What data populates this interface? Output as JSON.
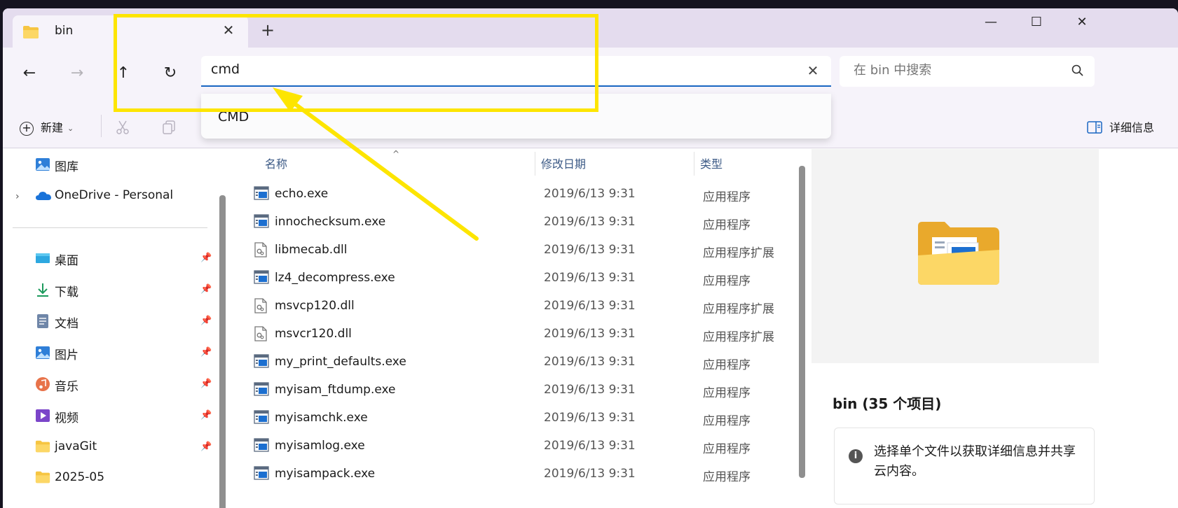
{
  "tab": {
    "title": "bin",
    "close": "✕"
  },
  "new_tab": "+",
  "window_controls": {
    "minimize": "—",
    "maximize": "☐",
    "close": "✕"
  },
  "nav": {
    "back": "←",
    "forward": "→",
    "up": "↑",
    "refresh": "↻"
  },
  "address": {
    "value": "cmd",
    "clear": "✕"
  },
  "suggestion": {
    "label": "CMD"
  },
  "search": {
    "placeholder": "在 bin 中搜索"
  },
  "toolbar": {
    "new_label": "新建",
    "details_label": "详细信息"
  },
  "sidebar": {
    "items": [
      {
        "label": "图库",
        "icon": "gallery-icon",
        "pinned": false
      },
      {
        "label": "OneDrive - Personal",
        "icon": "onedrive-icon",
        "pinned": false
      },
      {
        "label": "桌面",
        "icon": "desktop-icon",
        "pinned": true
      },
      {
        "label": "下载",
        "icon": "download-icon",
        "pinned": true
      },
      {
        "label": "文档",
        "icon": "document-icon",
        "pinned": true
      },
      {
        "label": "图片",
        "icon": "pictures-icon",
        "pinned": true
      },
      {
        "label": "音乐",
        "icon": "music-icon",
        "pinned": true
      },
      {
        "label": "视频",
        "icon": "video-icon",
        "pinned": true
      },
      {
        "label": "javaGit",
        "icon": "folder-icon",
        "pinned": true
      },
      {
        "label": "2025-05",
        "icon": "folder-icon",
        "pinned": false
      }
    ]
  },
  "filelist": {
    "columns": {
      "name": "名称",
      "date": "修改日期",
      "type": "类型"
    },
    "rows": [
      {
        "name": "echo.exe",
        "date": "2019/6/13 9:31",
        "type": "应用程序",
        "kind": "exe"
      },
      {
        "name": "innochecksum.exe",
        "date": "2019/6/13 9:31",
        "type": "应用程序",
        "kind": "exe"
      },
      {
        "name": "libmecab.dll",
        "date": "2019/6/13 9:31",
        "type": "应用程序扩展",
        "kind": "dll"
      },
      {
        "name": "lz4_decompress.exe",
        "date": "2019/6/13 9:31",
        "type": "应用程序",
        "kind": "exe"
      },
      {
        "name": "msvcp120.dll",
        "date": "2019/6/13 9:31",
        "type": "应用程序扩展",
        "kind": "dll"
      },
      {
        "name": "msvcr120.dll",
        "date": "2019/6/13 9:31",
        "type": "应用程序扩展",
        "kind": "dll"
      },
      {
        "name": "my_print_defaults.exe",
        "date": "2019/6/13 9:31",
        "type": "应用程序",
        "kind": "exe"
      },
      {
        "name": "myisam_ftdump.exe",
        "date": "2019/6/13 9:31",
        "type": "应用程序",
        "kind": "exe"
      },
      {
        "name": "myisamchk.exe",
        "date": "2019/6/13 9:31",
        "type": "应用程序",
        "kind": "exe"
      },
      {
        "name": "myisamlog.exe",
        "date": "2019/6/13 9:31",
        "type": "应用程序",
        "kind": "exe"
      },
      {
        "name": "myisampack.exe",
        "date": "2019/6/13 9:31",
        "type": "应用程序",
        "kind": "exe"
      }
    ]
  },
  "details": {
    "title": "bin (35 个项目)",
    "info": "选择单个文件以获取详细信息并共享云内容。",
    "info_icon": "i"
  },
  "annotation": {
    "color": "#fde500"
  }
}
